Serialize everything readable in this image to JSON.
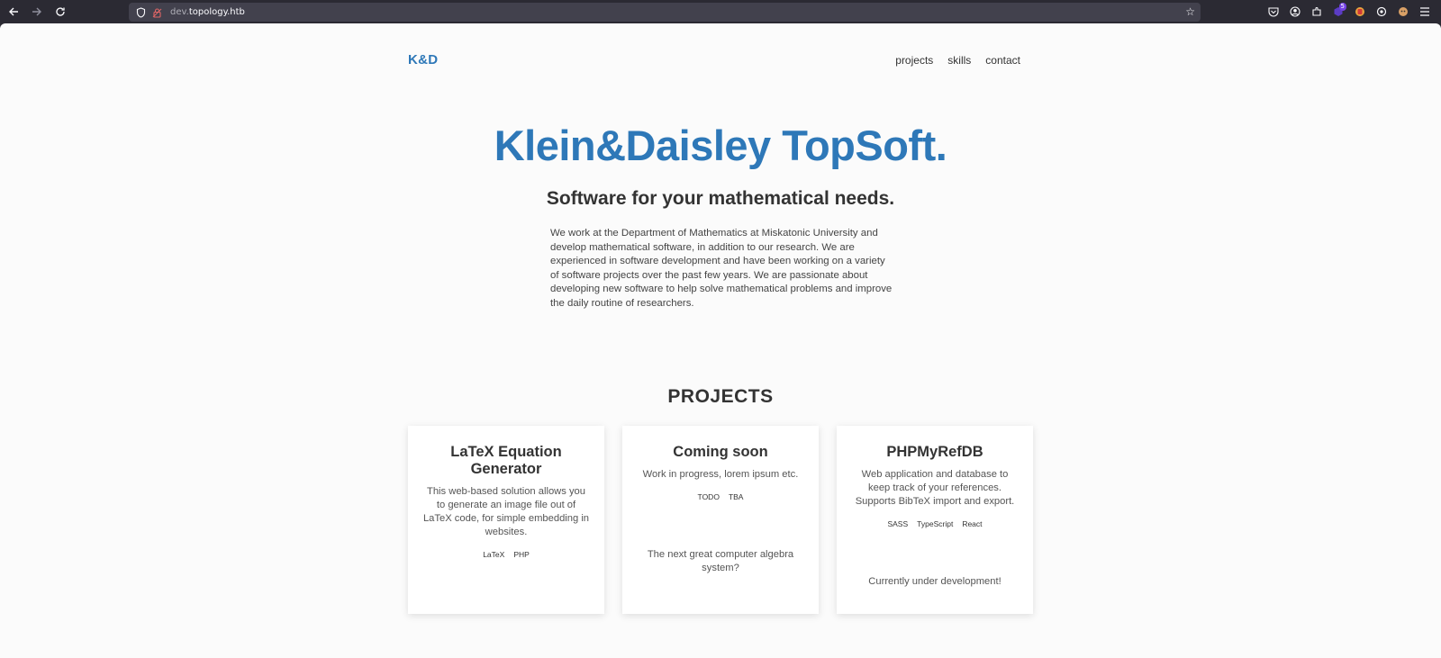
{
  "browser": {
    "url_subdomain": "dev.",
    "url_domain": "topology.htb",
    "extension_badge": "5"
  },
  "site": {
    "logo": "K&D",
    "nav": [
      "projects",
      "skills",
      "contact"
    ],
    "hero_title": "Klein&Daisley TopSoft.",
    "hero_subtitle": "Software for your mathematical needs.",
    "intro": "We work at the Department of Mathematics at Miskatonic University and develop mathematical software, in addition to our research. We are experienced in software development and have been working on a variety of software projects over the past few years. We are passionate about developing new software to help solve mathematical problems and improve the daily routine of researchers.",
    "projects_heading": "PROJECTS",
    "projects": [
      {
        "title": "LaTeX Equation Generator",
        "description": "This web-based solution allows you to generate an image file out of LaTeX code, for simple embedding in websites.",
        "tags": [
          "LaTeX",
          "PHP"
        ],
        "footer": ""
      },
      {
        "title": "Coming soon",
        "description": "Work in progress, lorem ipsum etc.",
        "tags": [
          "TODO",
          "TBA"
        ],
        "footer": "The next great computer algebra system?"
      },
      {
        "title": "PHPMyRefDB",
        "description": "Web application and database to keep track of your references. Supports BibTeX import and export.",
        "tags": [
          "SASS",
          "TypeScript",
          "React"
        ],
        "footer": "Currently under development!"
      }
    ]
  },
  "colors": {
    "accent": "#2e78b8",
    "chrome_bg": "#2b2a33",
    "urlbar_bg": "#42414d",
    "page_bg": "#fbfbfb"
  }
}
